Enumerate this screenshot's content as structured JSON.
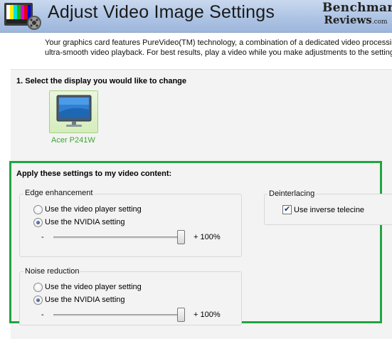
{
  "header": {
    "title": "Adjust Video Image Settings",
    "logo_line1": "Benchmark",
    "logo_line2": "Reviews",
    "logo_suffix": ".com"
  },
  "intro": {
    "line1": "Your graphics card features PureVideo(TM) technology, a combination of a dedicated video processing",
    "line2": "ultra-smooth video playback. For best results, play a video while you make adjustments to the settings."
  },
  "display_section": {
    "title": "1. Select the display you would like to change",
    "display_name": "Acer P241W",
    "selected": true
  },
  "video_section": {
    "title": "Apply these settings to my video content:",
    "edge": {
      "title": "Edge enhancement",
      "options": [
        "Use the video player setting",
        "Use the NVIDIA setting"
      ],
      "selected_index": 1,
      "minus_label": "-",
      "plus_label": "+ 100%",
      "slider_percent": 100
    },
    "noise": {
      "title": "Noise reduction",
      "options": [
        "Use the video player setting",
        "Use the NVIDIA setting"
      ],
      "selected_index": 1,
      "minus_label": "-",
      "plus_label": "+ 100%",
      "slider_percent": 100
    },
    "deinterlacing": {
      "title": "Deinterlacing",
      "checkbox_label": "Use inverse telecine",
      "checked": true
    }
  },
  "colors": {
    "highlight_border": "#21a540",
    "display_label": "#3aa82f",
    "header_bg": "#aec4e4"
  }
}
